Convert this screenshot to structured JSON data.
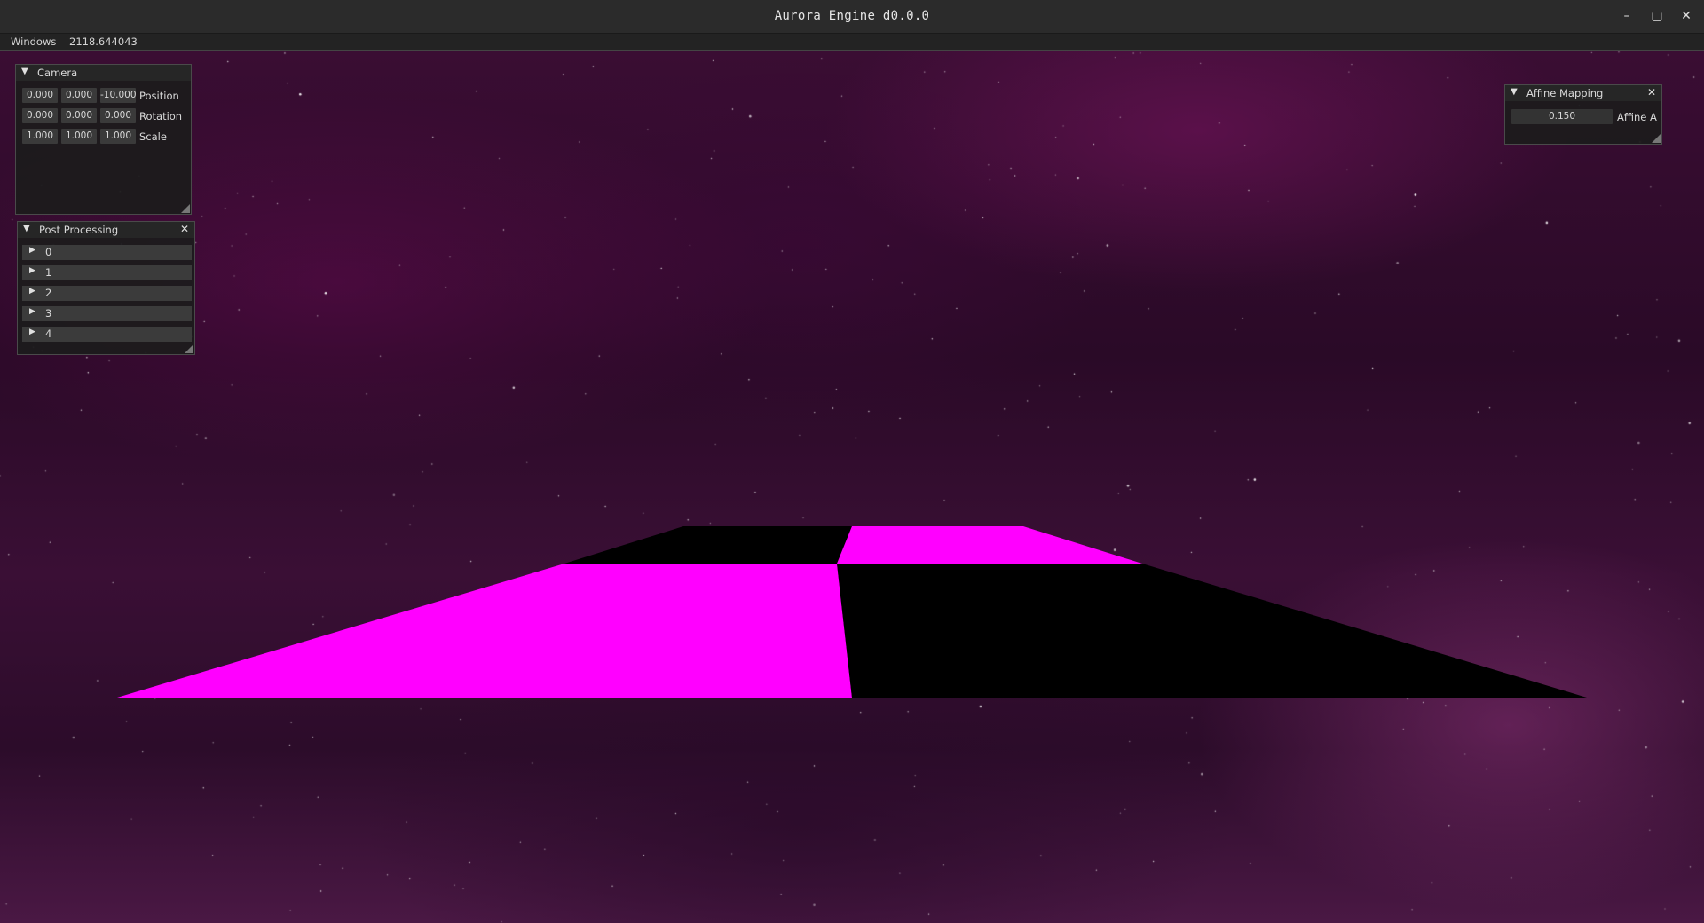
{
  "window": {
    "title": "Aurora Engine d0.0.0",
    "minimize_glyph": "–",
    "restore_glyph": "▢",
    "close_glyph": "✕"
  },
  "menubar": {
    "menu_label": "Windows",
    "frame_value": "2118.644043"
  },
  "camera_panel": {
    "title": "Camera",
    "collapse_glyph": "▼",
    "rows": [
      {
        "label": "Position",
        "values": [
          "0.000",
          "0.000",
          "-10.000"
        ]
      },
      {
        "label": "Rotation",
        "values": [
          "0.000",
          "0.000",
          "0.000"
        ]
      },
      {
        "label": "Scale",
        "values": [
          "1.000",
          "1.000",
          "1.000"
        ]
      }
    ]
  },
  "post_processing_panel": {
    "title": "Post Processing",
    "collapse_glyph": "▼",
    "close_glyph": "✕",
    "expand_glyph": "▶",
    "items": [
      "0",
      "1",
      "2",
      "3",
      "4"
    ]
  },
  "affine_panel": {
    "title": "Affine Mapping",
    "collapse_glyph": "▼",
    "close_glyph": "✕",
    "value": "0.150",
    "label": "Affine A"
  },
  "scene": {
    "floor_colors": [
      "#ff00ff",
      "#000000"
    ]
  }
}
